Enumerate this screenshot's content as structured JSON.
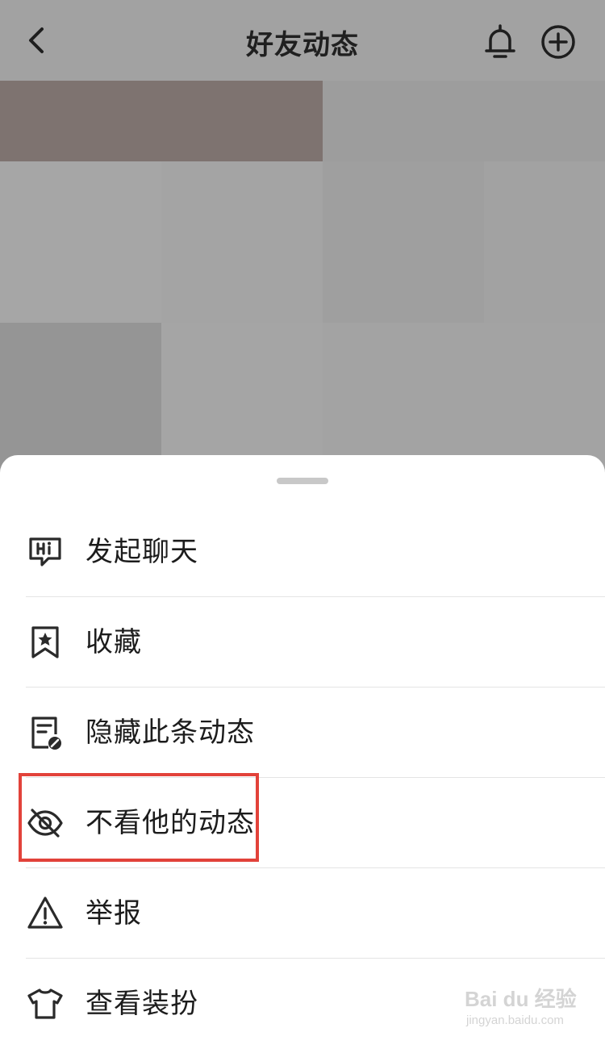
{
  "header": {
    "title": "好友动态",
    "back_icon": "chevron-left-icon",
    "bell_icon": "bell-icon",
    "add_icon": "plus-circle-icon"
  },
  "menu": {
    "items": [
      {
        "label": "发起聊天",
        "icon": "chat-hi-icon"
      },
      {
        "label": "收藏",
        "icon": "bookmark-star-icon"
      },
      {
        "label": "隐藏此条动态",
        "icon": "document-blocked-icon"
      },
      {
        "label": "不看他的动态",
        "icon": "eye-slash-icon"
      },
      {
        "label": "举报",
        "icon": "warning-triangle-icon"
      },
      {
        "label": "查看装扮",
        "icon": "tshirt-icon"
      }
    ]
  },
  "watermark": {
    "text": "Bai du 经验",
    "url_text": "jingyan.baidu.com"
  },
  "colors": {
    "overlay_background": "#a5a5a5",
    "sheet_background": "#ffffff",
    "highlight_border": "#e2423a"
  }
}
